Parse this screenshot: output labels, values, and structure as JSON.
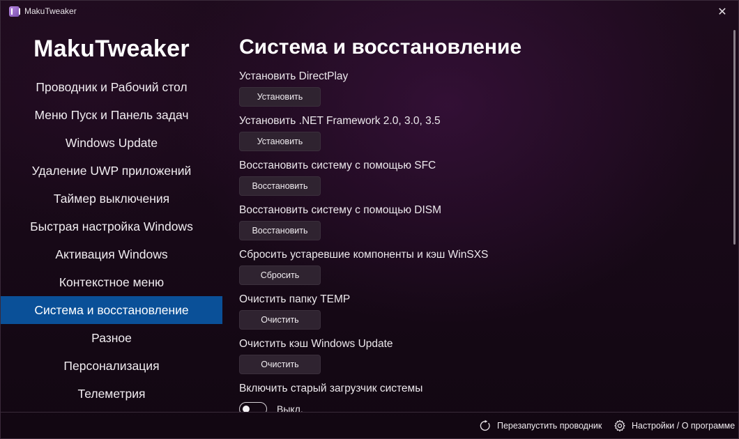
{
  "window": {
    "title": "MakuTweaker",
    "close_glyph": "✕"
  },
  "sidebar": {
    "app_name": "MakuTweaker",
    "items": [
      {
        "label": "Проводник и Рабочий стол"
      },
      {
        "label": "Меню Пуск и Панель задач"
      },
      {
        "label": "Windows Update"
      },
      {
        "label": "Удаление UWP приложений"
      },
      {
        "label": "Таймер выключения"
      },
      {
        "label": "Быстрая настройка Windows"
      },
      {
        "label": "Активация Windows"
      },
      {
        "label": "Контекстное меню"
      },
      {
        "label": "Система и восстановление"
      },
      {
        "label": "Разное"
      },
      {
        "label": "Персонализация"
      },
      {
        "label": "Телеметрия"
      }
    ],
    "active_index": 8,
    "active_color": "#0a5098"
  },
  "main": {
    "title": "Система и восстановление",
    "settings": [
      {
        "label": "Установить DirectPlay",
        "button": "Установить"
      },
      {
        "label": "Установить .NET Framework 2.0, 3.0, 3.5",
        "button": "Установить"
      },
      {
        "label": "Восстановить систему с помощью SFC",
        "button": "Восстановить"
      },
      {
        "label": "Восстановить систему с помощью DISM",
        "button": "Восстановить"
      },
      {
        "label": "Сбросить устаревшие компоненты и кэш WinSXS",
        "button": "Сбросить"
      },
      {
        "label": "Очистить папку TEMP",
        "button": "Очистить"
      },
      {
        "label": "Очистить кэш Windows Update",
        "button": "Очистить"
      },
      {
        "label": "Включить старый загрузчик системы",
        "toggle_state": "Выкл.",
        "toggle_on": false
      }
    ]
  },
  "footer": {
    "restart": {
      "label": "Перезапустить проводник",
      "icon": "restart-icon"
    },
    "settings": {
      "label": "Настройки / О программе",
      "icon": "gear-icon"
    }
  },
  "colors": {
    "background": "#170917",
    "accent": "#0a5098",
    "button_bg": "#2f2330"
  }
}
